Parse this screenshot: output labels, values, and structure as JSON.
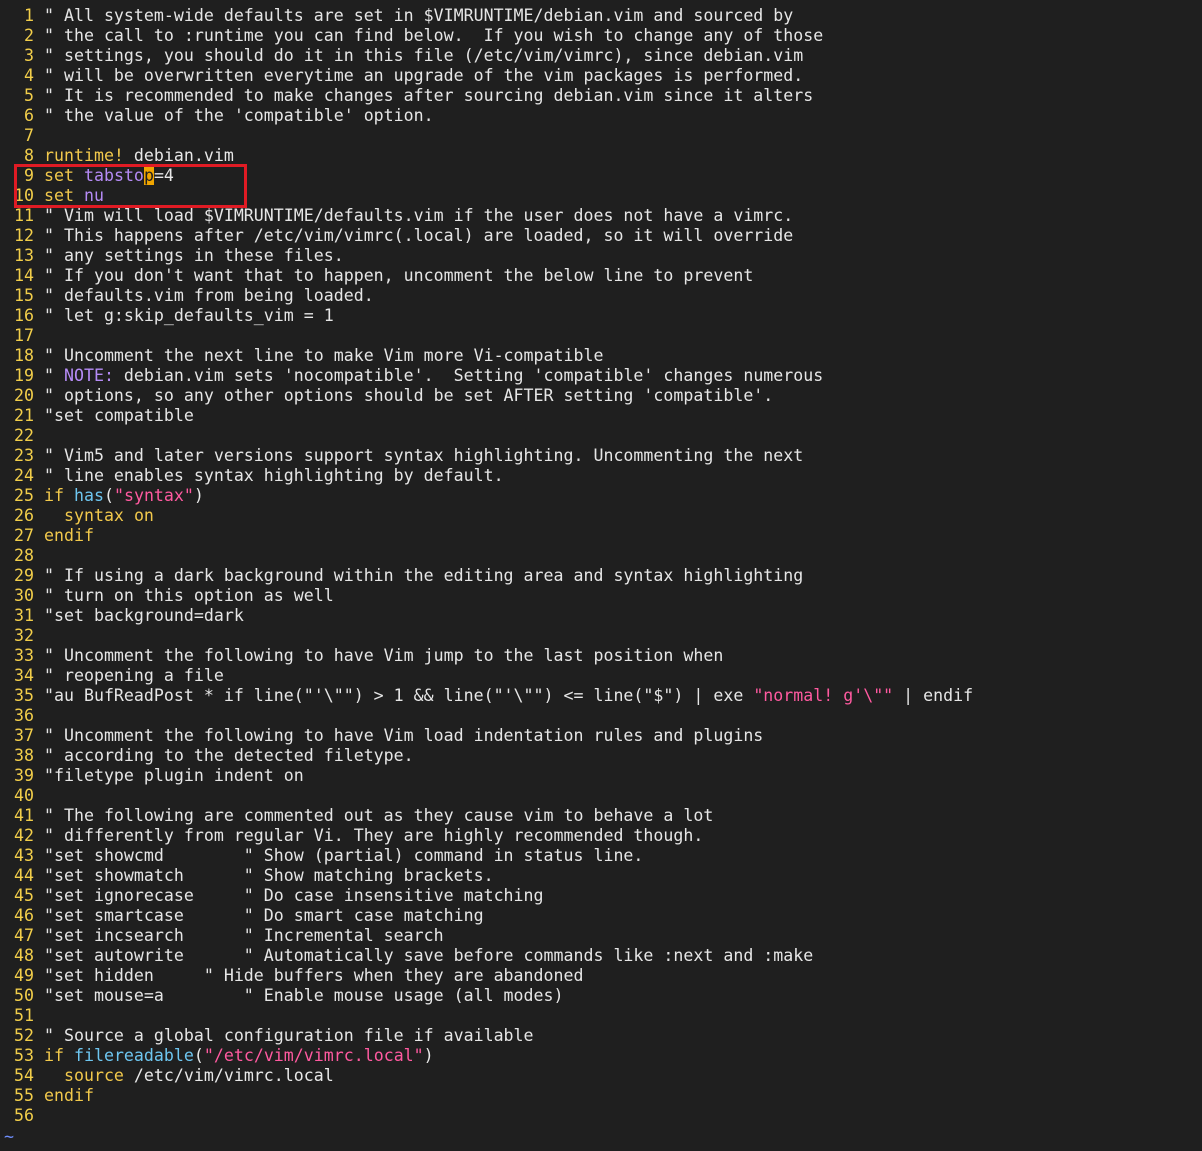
{
  "editor": {
    "colors": {
      "background": "#1f1f1f",
      "line_number": "#f2ce4a",
      "keyword": "#f2c94c",
      "option": "#b58bf5",
      "string": "#ff5aa0",
      "function": "#6ec6f0",
      "comment": "#e6e6e6",
      "cursor": "#f0a500",
      "annotation_box": "#e01b24",
      "tilde": "#6f8fff"
    },
    "empty_line_marker": "~",
    "lines": [
      {
        "n": "1",
        "segs": [
          [
            "comment",
            "\" All system-wide defaults are set in $VIMRUNTIME/debian.vim and sourced by"
          ]
        ]
      },
      {
        "n": "2",
        "segs": [
          [
            "comment",
            "\" the call to :runtime you can find below.  If you wish to change any of those"
          ]
        ]
      },
      {
        "n": "3",
        "segs": [
          [
            "comment",
            "\" settings, you should do it in this file (/etc/vim/vimrc), since debian.vim"
          ]
        ]
      },
      {
        "n": "4",
        "segs": [
          [
            "comment",
            "\" will be overwritten everytime an upgrade of the vim packages is performed."
          ]
        ]
      },
      {
        "n": "5",
        "segs": [
          [
            "comment",
            "\" It is recommended to make changes after sourcing debian.vim since it alters"
          ]
        ]
      },
      {
        "n": "6",
        "segs": [
          [
            "comment",
            "\" the value of the 'compatible' option."
          ]
        ]
      },
      {
        "n": "7",
        "segs": []
      },
      {
        "n": "8",
        "segs": [
          [
            "kw",
            "runtime!"
          ],
          [
            "plain",
            " debian.vim"
          ]
        ]
      },
      {
        "n": "9",
        "segs": [
          [
            "kw",
            "set"
          ],
          [
            "plain",
            " "
          ],
          [
            "opt",
            "tabsto"
          ],
          [
            "cursor",
            "p"
          ],
          [
            "plain",
            "=4"
          ]
        ]
      },
      {
        "n": "10",
        "segs": [
          [
            "kw",
            "set"
          ],
          [
            "plain",
            " "
          ],
          [
            "opt",
            "nu"
          ]
        ]
      },
      {
        "n": "11",
        "segs": [
          [
            "comment",
            "\" Vim will load $VIMRUNTIME/defaults.vim if the user does not have a vimrc."
          ]
        ]
      },
      {
        "n": "12",
        "segs": [
          [
            "comment",
            "\" This happens after /etc/vim/vimrc(.local) are loaded, so it will override"
          ]
        ]
      },
      {
        "n": "13",
        "segs": [
          [
            "comment",
            "\" any settings in these files."
          ]
        ]
      },
      {
        "n": "14",
        "segs": [
          [
            "comment",
            "\" If you don't want that to happen, uncomment the below line to prevent"
          ]
        ]
      },
      {
        "n": "15",
        "segs": [
          [
            "comment",
            "\" defaults.vim from being loaded."
          ]
        ]
      },
      {
        "n": "16",
        "segs": [
          [
            "comment",
            "\" let g:skip_defaults_vim = 1"
          ]
        ]
      },
      {
        "n": "17",
        "segs": []
      },
      {
        "n": "18",
        "segs": [
          [
            "comment",
            "\" Uncomment the next line to make Vim more Vi-compatible"
          ]
        ]
      },
      {
        "n": "19",
        "segs": [
          [
            "comment",
            "\" "
          ],
          [
            "todo",
            "NOTE:"
          ],
          [
            "comment",
            " debian.vim sets 'nocompatible'.  Setting 'compatible' changes numerous"
          ]
        ]
      },
      {
        "n": "20",
        "segs": [
          [
            "comment",
            "\" options, so any other options should be set AFTER setting 'compatible'."
          ]
        ]
      },
      {
        "n": "21",
        "segs": [
          [
            "comment",
            "\"set compatible"
          ]
        ]
      },
      {
        "n": "22",
        "segs": []
      },
      {
        "n": "23",
        "segs": [
          [
            "comment",
            "\" Vim5 and later versions support syntax highlighting. Uncommenting the next"
          ]
        ]
      },
      {
        "n": "24",
        "segs": [
          [
            "comment",
            "\" line enables syntax highlighting by default."
          ]
        ]
      },
      {
        "n": "25",
        "segs": [
          [
            "kw",
            "if"
          ],
          [
            "plain",
            " "
          ],
          [
            "fn",
            "has"
          ],
          [
            "plain",
            "("
          ],
          [
            "str",
            "\"syntax\""
          ],
          [
            "plain",
            ")"
          ]
        ]
      },
      {
        "n": "26",
        "segs": [
          [
            "plain",
            "  "
          ],
          [
            "kw",
            "syntax"
          ],
          [
            "plain",
            " "
          ],
          [
            "kw",
            "on"
          ]
        ]
      },
      {
        "n": "27",
        "segs": [
          [
            "kw",
            "endif"
          ]
        ]
      },
      {
        "n": "28",
        "segs": []
      },
      {
        "n": "29",
        "segs": [
          [
            "comment",
            "\" If using a dark background within the editing area and syntax highlighting"
          ]
        ]
      },
      {
        "n": "30",
        "segs": [
          [
            "comment",
            "\" turn on this option as well"
          ]
        ]
      },
      {
        "n": "31",
        "segs": [
          [
            "comment",
            "\"set background=dark"
          ]
        ]
      },
      {
        "n": "32",
        "segs": []
      },
      {
        "n": "33",
        "segs": [
          [
            "comment",
            "\" Uncomment the following to have Vim jump to the last position when"
          ]
        ]
      },
      {
        "n": "34",
        "segs": [
          [
            "comment",
            "\" reopening a file"
          ]
        ]
      },
      {
        "n": "35",
        "segs": [
          [
            "comment",
            "\"au BufReadPost * if line(\"'\\\"\") > 1 && line(\"'\\\"\") <= line(\"$\") | exe "
          ],
          [
            "str",
            "\"normal! g'\\\"\""
          ],
          [
            "comment",
            " | endif"
          ]
        ]
      },
      {
        "n": "36",
        "segs": []
      },
      {
        "n": "37",
        "segs": [
          [
            "comment",
            "\" Uncomment the following to have Vim load indentation rules and plugins"
          ]
        ]
      },
      {
        "n": "38",
        "segs": [
          [
            "comment",
            "\" according to the detected filetype."
          ]
        ]
      },
      {
        "n": "39",
        "segs": [
          [
            "comment",
            "\"filetype plugin indent on"
          ]
        ]
      },
      {
        "n": "40",
        "segs": []
      },
      {
        "n": "41",
        "segs": [
          [
            "comment",
            "\" The following are commented out as they cause vim to behave a lot"
          ]
        ]
      },
      {
        "n": "42",
        "segs": [
          [
            "comment",
            "\" differently from regular Vi. They are highly recommended though."
          ]
        ]
      },
      {
        "n": "43",
        "segs": [
          [
            "comment",
            "\"set showcmd        \" Show (partial) command in status line."
          ]
        ]
      },
      {
        "n": "44",
        "segs": [
          [
            "comment",
            "\"set showmatch      \" Show matching brackets."
          ]
        ]
      },
      {
        "n": "45",
        "segs": [
          [
            "comment",
            "\"set ignorecase     \" Do case insensitive matching"
          ]
        ]
      },
      {
        "n": "46",
        "segs": [
          [
            "comment",
            "\"set smartcase      \" Do smart case matching"
          ]
        ]
      },
      {
        "n": "47",
        "segs": [
          [
            "comment",
            "\"set incsearch      \" Incremental search"
          ]
        ]
      },
      {
        "n": "48",
        "segs": [
          [
            "comment",
            "\"set autowrite      \" Automatically save before commands like :next and :make"
          ]
        ]
      },
      {
        "n": "49",
        "segs": [
          [
            "comment",
            "\"set hidden     \" Hide buffers when they are abandoned"
          ]
        ]
      },
      {
        "n": "50",
        "segs": [
          [
            "comment",
            "\"set mouse=a        \" Enable mouse usage (all modes)"
          ]
        ]
      },
      {
        "n": "51",
        "segs": []
      },
      {
        "n": "52",
        "segs": [
          [
            "comment",
            "\" Source a global configuration file if available"
          ]
        ]
      },
      {
        "n": "53",
        "segs": [
          [
            "kw",
            "if"
          ],
          [
            "plain",
            " "
          ],
          [
            "fn",
            "filereadable"
          ],
          [
            "plain",
            "("
          ],
          [
            "str",
            "\"/etc/vim/vimrc.local\""
          ],
          [
            "plain",
            ")"
          ]
        ]
      },
      {
        "n": "54",
        "segs": [
          [
            "plain",
            "  "
          ],
          [
            "kw",
            "source"
          ],
          [
            "plain",
            " /etc/vim/vimrc.local"
          ]
        ]
      },
      {
        "n": "55",
        "segs": [
          [
            "kw",
            "endif"
          ]
        ]
      },
      {
        "n": "56",
        "segs": []
      }
    ]
  }
}
